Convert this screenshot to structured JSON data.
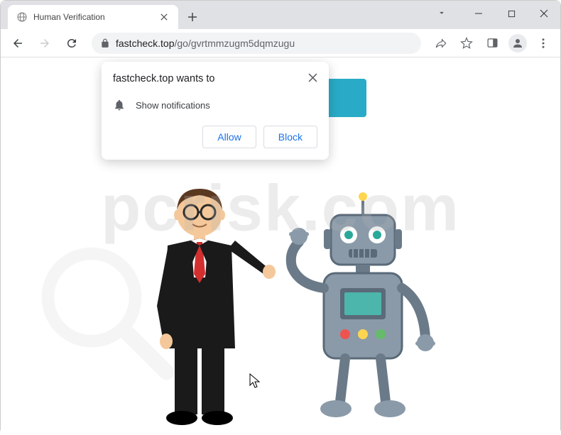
{
  "tab": {
    "title": "Human Verification"
  },
  "address": {
    "domain": "fastcheck.top",
    "path": "/go/gvrtmmzugm5dqmzugu"
  },
  "notification": {
    "title": "fastcheck.top wants to",
    "permission_text": "Show notifications",
    "allow_label": "Allow",
    "block_label": "Block"
  },
  "watermark": {
    "text": "pcrisk.com"
  }
}
